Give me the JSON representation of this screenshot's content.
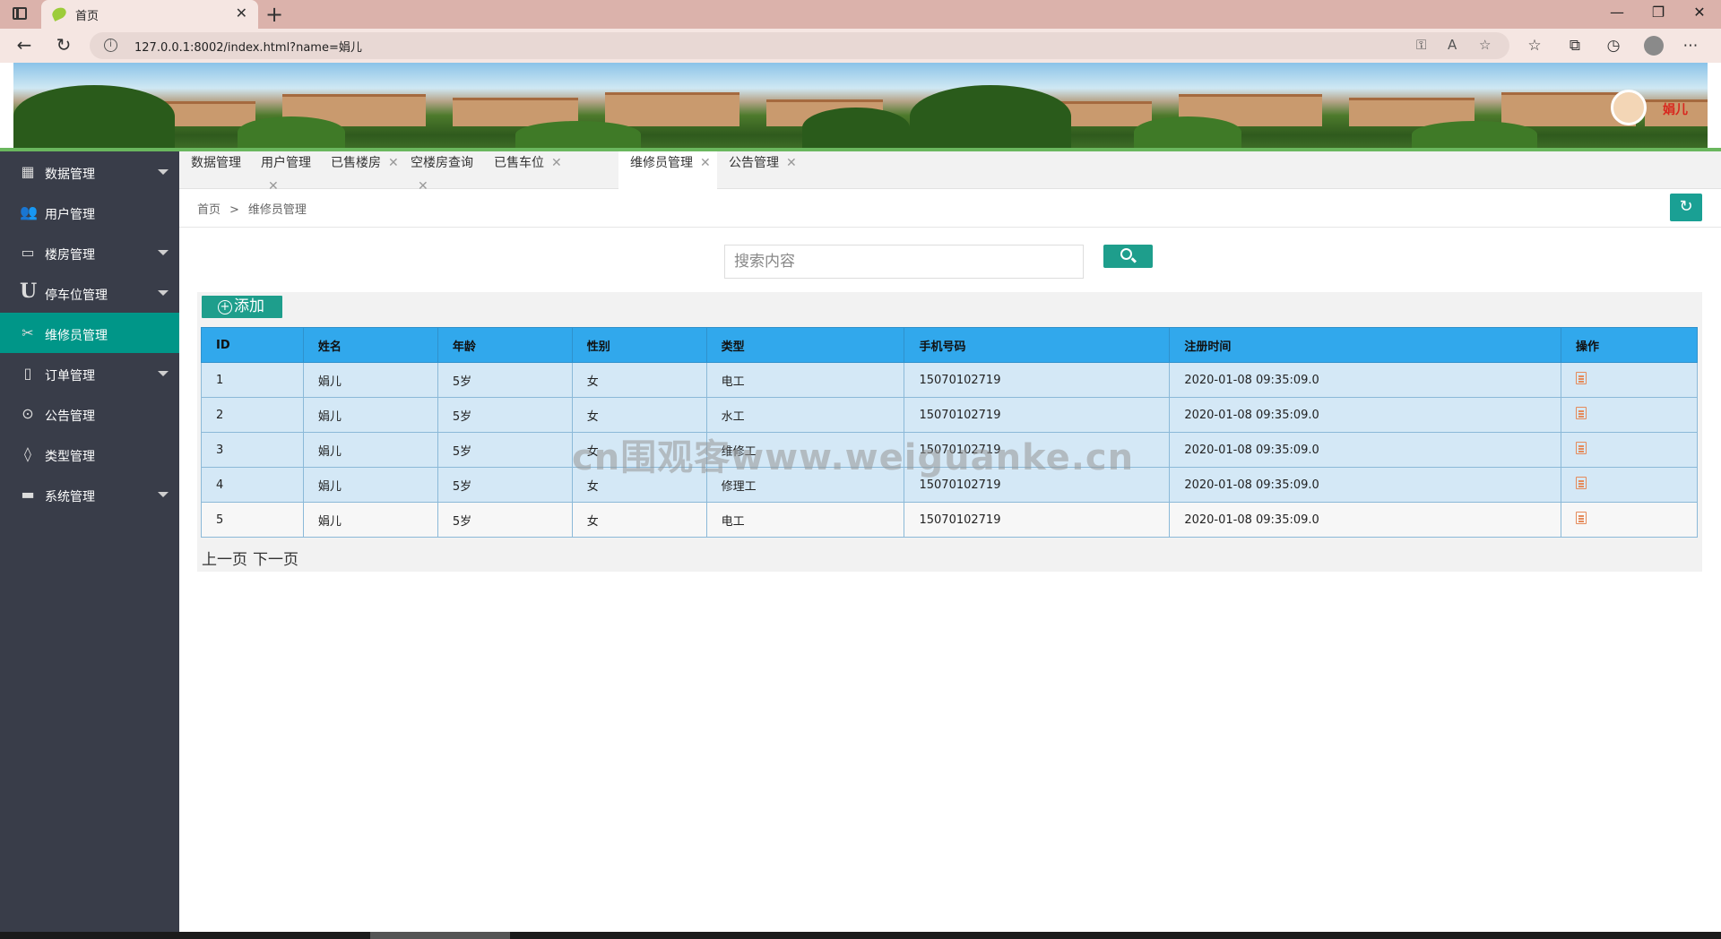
{
  "browser": {
    "tab_title": "首页",
    "url": "127.0.0.1:8002/index.html?name=娟儿"
  },
  "header": {
    "user_name": "娟儿"
  },
  "sidebar": {
    "items": [
      {
        "label": "数据管理",
        "icon": "grid-icon",
        "arrow": true
      },
      {
        "label": "用户管理",
        "icon": "users-icon",
        "arrow": false
      },
      {
        "label": "楼房管理",
        "icon": "window-icon",
        "arrow": true
      },
      {
        "label": "停车位管理",
        "icon": "u-letter-icon",
        "arrow": true
      },
      {
        "label": "维修员管理",
        "icon": "tools-icon",
        "arrow": false,
        "active": true
      },
      {
        "label": "订单管理",
        "icon": "document-icon",
        "arrow": true
      },
      {
        "label": "公告管理",
        "icon": "circle-arrow-icon",
        "arrow": false
      },
      {
        "label": "类型管理",
        "icon": "drops-icon",
        "arrow": false
      },
      {
        "label": "系统管理",
        "icon": "printer-icon",
        "arrow": true
      }
    ]
  },
  "page_tabs": [
    {
      "label": "数据管理",
      "closable": false
    },
    {
      "label": "用户管理",
      "closable": true
    },
    {
      "label": "已售楼房",
      "closable": true
    },
    {
      "label": "空楼房查询",
      "closable": true
    },
    {
      "label": "已售车位",
      "closable": true
    },
    {
      "label": "维修员管理",
      "closable": true,
      "active": true
    },
    {
      "label": "公告管理",
      "closable": true
    }
  ],
  "breadcrumb": {
    "home": "首页",
    "separator": ">",
    "current": "维修员管理"
  },
  "search": {
    "placeholder": "搜索内容",
    "value": ""
  },
  "toolbar": {
    "add_label": "添加"
  },
  "table": {
    "columns": [
      "ID",
      "姓名",
      "年龄",
      "性别",
      "类型",
      "手机号码",
      "注册时间",
      "操作"
    ],
    "rows": [
      [
        "1",
        "娟儿",
        "5岁",
        "女",
        "电工",
        "15070102719",
        "2020-01-08 09:35:09.0"
      ],
      [
        "2",
        "娟儿",
        "5岁",
        "女",
        "水工",
        "15070102719",
        "2020-01-08 09:35:09.0"
      ],
      [
        "3",
        "娟儿",
        "5岁",
        "女",
        "维修工",
        "15070102719",
        "2020-01-08 09:35:09.0"
      ],
      [
        "4",
        "娟儿",
        "5岁",
        "女",
        "修理工",
        "15070102719",
        "2020-01-08 09:35:09.0"
      ],
      [
        "5",
        "娟儿",
        "5岁",
        "女",
        "电工",
        "15070102719",
        "2020-01-08 09:35:09.0"
      ]
    ]
  },
  "pager": {
    "prev": "上一页",
    "next": "下一页"
  },
  "watermark": "cn围观客www.weiguanke.cn",
  "colors": {
    "sidebar_bg": "#393d49",
    "accent": "#009688",
    "table_header": "#31a8ec"
  }
}
